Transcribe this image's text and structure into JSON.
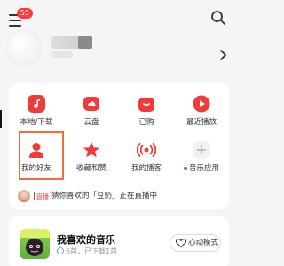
{
  "header": {
    "notification_badge": "55"
  },
  "quick_grid": [
    {
      "label": "本地/下载"
    },
    {
      "label": "云盘"
    },
    {
      "label": "已购"
    },
    {
      "label": "最近播放"
    },
    {
      "label": "我的好友"
    },
    {
      "label": "收藏和赞"
    },
    {
      "label": "我的播客"
    },
    {
      "label": "音乐应用"
    }
  ],
  "live": {
    "tag": "直播",
    "text": "猜你喜欢的「豆奶」正在直播中"
  },
  "favorite": {
    "title": "我喜欢的音乐",
    "subtitle": "6首，已下载1首",
    "heart_mode_label": "心动模式"
  },
  "colors": {
    "accent": "#f13a3a",
    "highlight_border": "#f26b3a",
    "background": "#f5f5f7"
  }
}
